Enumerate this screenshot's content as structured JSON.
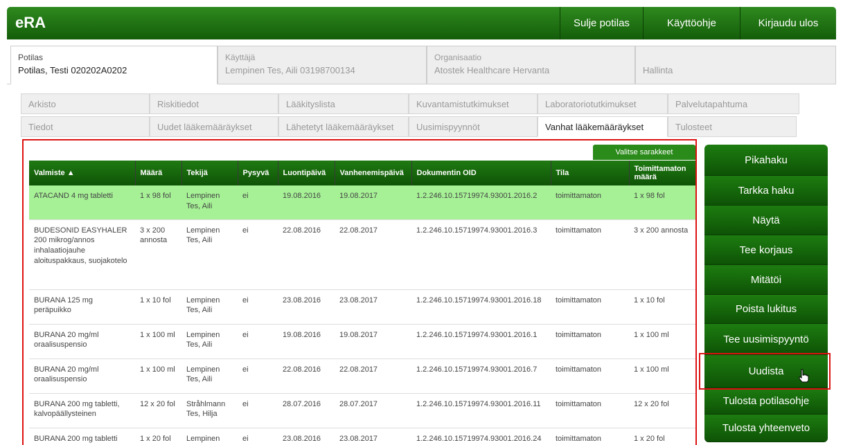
{
  "header": {
    "logo": "eRA",
    "buttons": [
      "Sulje potilas",
      "Käyttöohje",
      "Kirjaudu ulos"
    ]
  },
  "context_tabs": [
    {
      "label": "Potilas",
      "value": "Potilas, Testi 020202A0202"
    },
    {
      "label": "Käyttäjä",
      "value": "Lempinen Tes, Aili 03198700134"
    },
    {
      "label": "Organisaatio",
      "value": "Atostek Healthcare Hervanta"
    },
    {
      "label": "Hallinta",
      "value": ""
    }
  ],
  "sub_tabs_row1": [
    "Arkisto",
    "Riskitiedot",
    "Lääkityslista",
    "Kuvantamistutkimukset",
    "Laboratoriotutkimukset",
    "Palvelutapahtuma"
  ],
  "sub_tabs_row2": [
    "Tiedot",
    "Uudet lääkemääräykset",
    "Lähetetyt lääkemääräykset",
    "Uusimispyynnöt",
    "Vanhat lääkemääräykset",
    "Tulosteet"
  ],
  "valitse_label": "Valitse sarakkeet",
  "table": {
    "headers": [
      "Valmiste ▲",
      "Määrä",
      "Tekijä",
      "Pysyvä",
      "Luontipäivä",
      "Vanhenemispäivä",
      "Dokumentin OID",
      "Tila",
      "Toimittamaton määrä"
    ],
    "rows": [
      [
        "ATACAND 4 mg tabletti",
        "1 x 98 fol",
        "Lempinen Tes, Aili",
        "ei",
        "19.08.2016",
        "19.08.2017",
        "1.2.246.10.15719974.93001.2016.2",
        "toimittamaton",
        "1 x 98 fol"
      ],
      [
        "BUDESONID EASYHALER 200 mikrog/annos inhalaatiojauhe aloituspakkaus, suojakotelo",
        "3 x 200 annosta",
        "Lempinen Tes, Aili",
        "ei",
        "22.08.2016",
        "22.08.2017",
        "1.2.246.10.15719974.93001.2016.3",
        "toimittamaton",
        "3 x 200 annosta"
      ],
      [
        "BURANA 125 mg peräpuikko",
        "1 x 10 fol",
        "Lempinen Tes, Aili",
        "ei",
        "23.08.2016",
        "23.08.2017",
        "1.2.246.10.15719974.93001.2016.18",
        "toimittamaton",
        "1 x 10 fol"
      ],
      [
        "BURANA 20 mg/ml oraalisuspensio",
        "1 x 100 ml",
        "Lempinen Tes, Aili",
        "ei",
        "19.08.2016",
        "19.08.2017",
        "1.2.246.10.15719974.93001.2016.1",
        "toimittamaton",
        "1 x 100 ml"
      ],
      [
        "BURANA 20 mg/ml oraalisuspensio",
        "1 x 100 ml",
        "Lempinen Tes, Aili",
        "ei",
        "22.08.2016",
        "22.08.2017",
        "1.2.246.10.15719974.93001.2016.7",
        "toimittamaton",
        "1 x 100 ml"
      ],
      [
        "BURANA 200 mg tabletti, kalvopäällysteinen",
        "12 x 20 fol",
        "Stråhlmann Tes, Hilja",
        "ei",
        "28.07.2016",
        "28.07.2017",
        "1.2.246.10.15719974.93001.2016.11",
        "toimittamaton",
        "12 x 20 fol"
      ],
      [
        "BURANA 200 mg tabletti",
        "1 x 20 fol",
        "Lempinen",
        "ei",
        "23.08.2016",
        "23.08.2017",
        "1.2.246.10.15719974.93001.2016.24",
        "toimittamaton",
        "1 x 20 fol"
      ]
    ]
  },
  "side_buttons": [
    "Pikahaku",
    "Tarkka haku",
    "Näytä",
    "Tee korjaus",
    "Mitätöi",
    "Poista lukitus",
    "Tee uusimispyyntö",
    "Uudista",
    "Tulosta potilasohje",
    "Tulosta yhteenveto"
  ],
  "colors": {
    "brand_green": "#1d7c10",
    "selected_row": "#a6f196",
    "highlight_red": "#dd1111"
  }
}
